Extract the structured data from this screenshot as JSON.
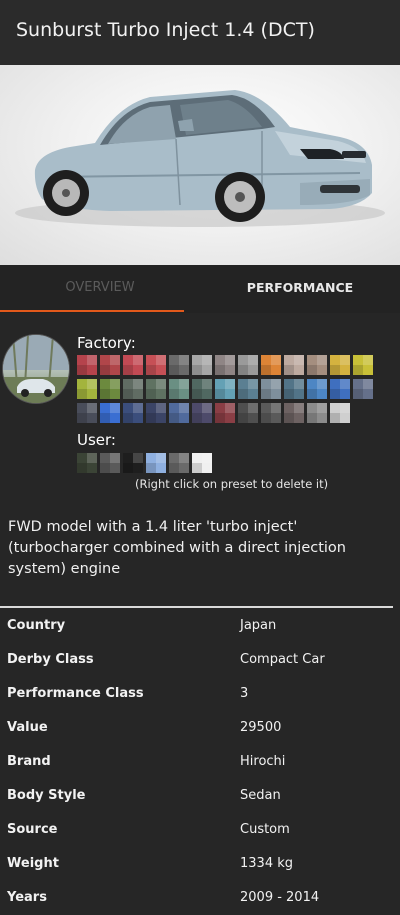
{
  "header": {
    "title": "Sunburst Turbo Inject 1.4 (DCT)"
  },
  "preview": {
    "car_color": "#a9bdc9"
  },
  "tabs": [
    {
      "label": "OVERVIEW",
      "active": false
    },
    {
      "label": "PERFORMANCE",
      "active": true
    }
  ],
  "accent_color": "#e2591b",
  "paint": {
    "factory_label": "Factory:",
    "user_label": "User:",
    "user_hint": "(Right click on preset to delete it)",
    "factory_swatches": [
      "#b5434c",
      "#b0464a",
      "#c24a54",
      "#c65056",
      "#6a6a6a",
      "#a7a7a7",
      "#8f8585",
      "#9a9a9a",
      "#dd8436",
      "#bdaaa0",
      "#a48e7f",
      "#d4b23f",
      "#c8c038",
      "#a3b43d",
      "#6c8a3e",
      "#606c63",
      "#5f7262",
      "#6a8f83",
      "#506861",
      "#64a1b5",
      "#5b7f92",
      "#7e8f9c",
      "#527488",
      "#4d86c4",
      "#3f6fbf",
      "#65708a",
      "#494d5a",
      "#3a6ed2",
      "#3b4e7c",
      "#3b4466",
      "#506a9c",
      "#4d4a6a",
      "#8a3e45",
      "#4f4f4f",
      "#5a5a5a",
      "#6d6262",
      "#8c8c8c",
      "#cfcfcf"
    ],
    "user_swatches": [
      "#3b4436",
      "#5a5a5a",
      "#1e1e1e",
      "#8fb0e0",
      "#6a6a6a",
      "#f0f0f0"
    ]
  },
  "description": "FWD model with a 1.4 liter 'turbo inject' (turbocharger combined with a direct injection system) engine",
  "specs": [
    {
      "label": "Country",
      "value": "Japan"
    },
    {
      "label": "Derby Class",
      "value": "Compact Car"
    },
    {
      "label": "Performance Class",
      "value": "3"
    },
    {
      "label": "Value",
      "value": "29500"
    },
    {
      "label": "Brand",
      "value": "Hirochi"
    },
    {
      "label": "Body Style",
      "value": "Sedan"
    },
    {
      "label": "Source",
      "value": "Custom"
    },
    {
      "label": "Weight",
      "value": "1334 kg"
    },
    {
      "label": "Years",
      "value": "2009 - 2014"
    }
  ]
}
